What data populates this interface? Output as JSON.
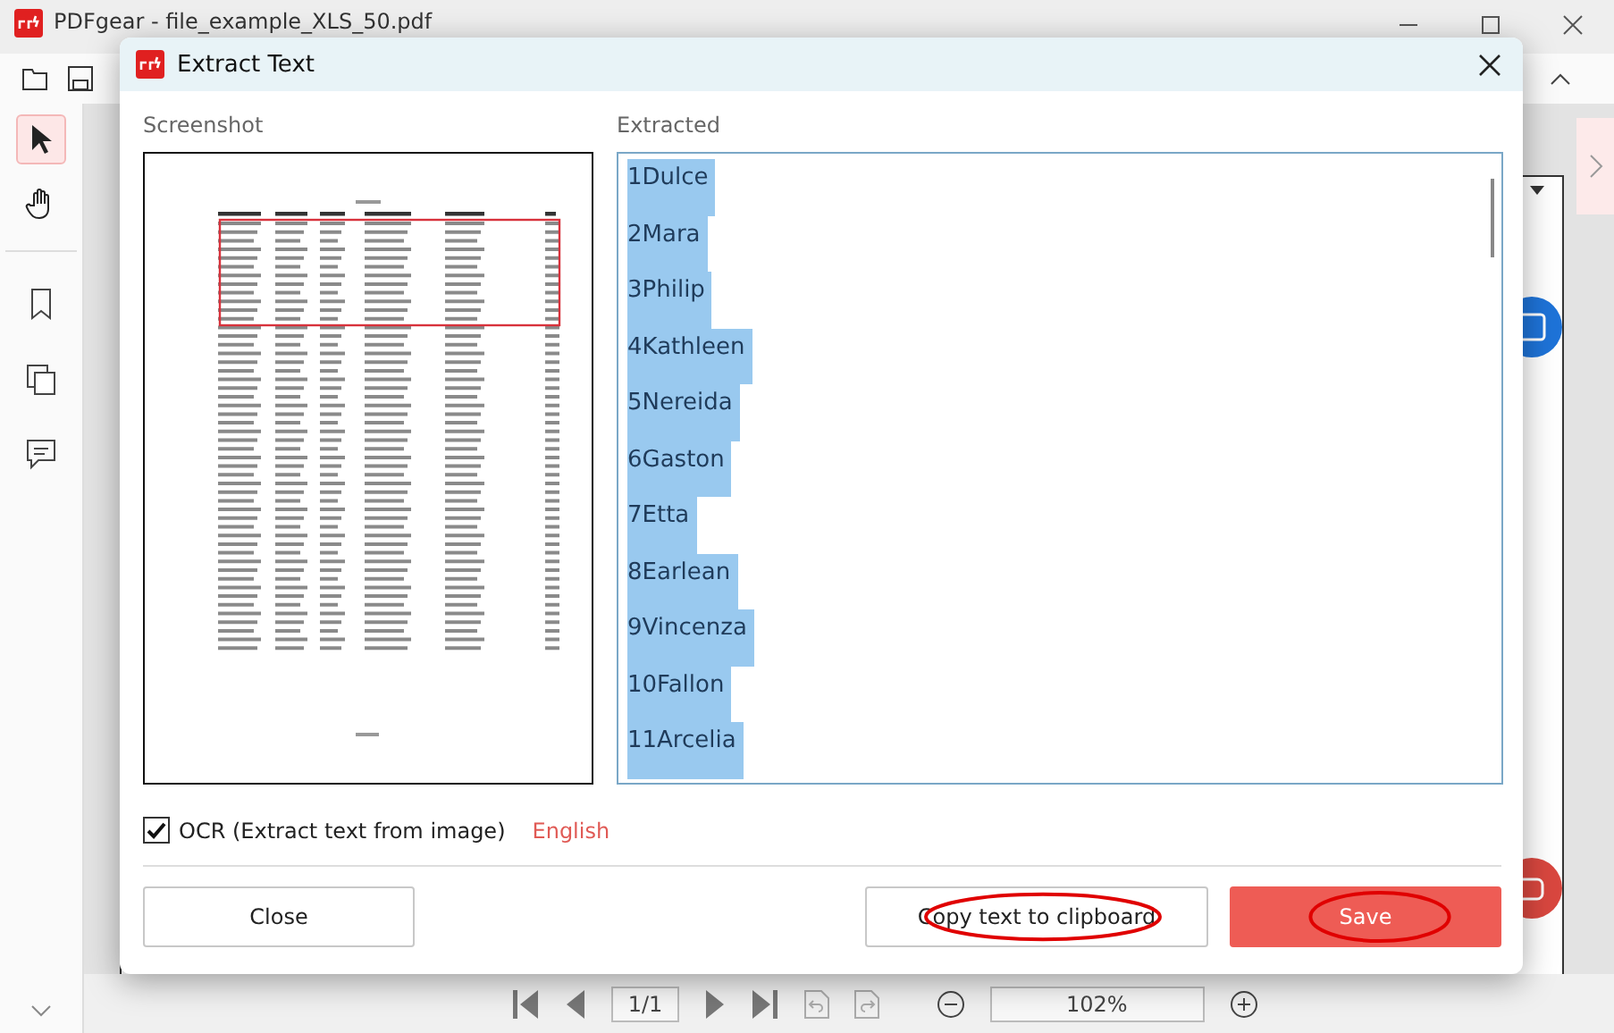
{
  "app": {
    "title": "PDFgear - file_example_XLS_50.pdf",
    "page_field": "1/1",
    "zoom": "102%"
  },
  "tools": [
    {
      "kind": "select",
      "selected": true
    },
    {
      "kind": "hand",
      "selected": false
    }
  ],
  "dialog": {
    "title": "Extract Text",
    "screenshot_label": "Screenshot",
    "extracted_label": "Extracted",
    "extracted_selected": true,
    "extracted_lines": [
      "1Dulce",
      "2Mara",
      "3Philip",
      "4Kathleen",
      "5Nereida",
      "6Gaston",
      "7Etta",
      "8Earlean",
      "9Vincenza",
      "10Fallon",
      "11Arcelia"
    ],
    "ocr": {
      "label": "OCR (Extract text from image)",
      "checked": true,
      "language": "English"
    },
    "buttons": [
      {
        "label": "Close",
        "kind": "plain",
        "annotated": false
      },
      {
        "label": "Copy text to clipboard",
        "kind": "plain",
        "annotated": true
      },
      {
        "label": "Save",
        "kind": "primary",
        "annotated": true
      }
    ]
  }
}
